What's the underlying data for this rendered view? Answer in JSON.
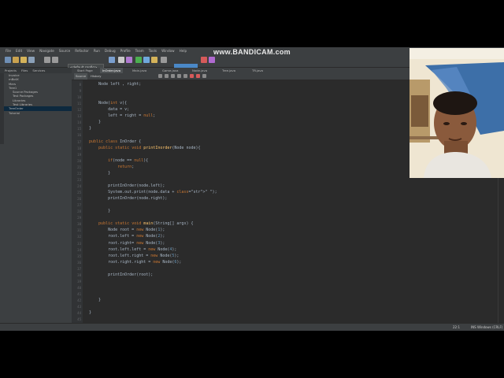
{
  "watermark": "www.BANDICAM.com",
  "menu": [
    "File",
    "Edit",
    "View",
    "Navigate",
    "Source",
    "Refactor",
    "Run",
    "Debug",
    "Profile",
    "Team",
    "Tools",
    "Window",
    "Help"
  ],
  "toolbar": {
    "config_value": "<default config>"
  },
  "left_panel": {
    "tabs": [
      "Projects",
      "Files",
      "Services"
    ],
    "tree": [
      {
        "label": "Invoice",
        "indent": 1,
        "selected": false
      },
      {
        "label": "mBotX",
        "indent": 1,
        "selected": false
      },
      {
        "label": "Mars",
        "indent": 1,
        "selected": false
      },
      {
        "label": "Tree1",
        "indent": 1,
        "selected": false
      },
      {
        "label": "Source Packages",
        "indent": 2,
        "selected": false
      },
      {
        "label": "Test Packages",
        "indent": 2,
        "selected": false
      },
      {
        "label": "Libraries",
        "indent": 2,
        "selected": false
      },
      {
        "label": "Test Libraries",
        "indent": 2,
        "selected": false
      },
      {
        "label": "TreeOrder",
        "indent": 1,
        "selected": true
      },
      {
        "label": "Tutorial",
        "indent": 1,
        "selected": false
      }
    ]
  },
  "editor_tabs": [
    "Start Page",
    "InOrder.java",
    "Main.java",
    "Game.java",
    "Node.java",
    "Tree.java",
    "TR.java"
  ],
  "editor_toolbar": {
    "source_label": "Source",
    "history_label": "History"
  },
  "code_lines": [
    {
      "n": "8",
      "html": "    Node left , right;"
    },
    {
      "n": "9",
      "html": ""
    },
    {
      "n": "10",
      "html": ""
    },
    {
      "n": "11",
      "html": "    Node(int v){"
    },
    {
      "n": "12",
      "html": "        data = v;"
    },
    {
      "n": "13",
      "html": "        left = right = null;"
    },
    {
      "n": "14",
      "html": "    }"
    },
    {
      "n": "15",
      "html": "}"
    },
    {
      "n": "16",
      "html": ""
    },
    {
      "n": "17",
      "html": "public class InOrder {"
    },
    {
      "n": "18",
      "html": "    public static void printInorder(Node node){"
    },
    {
      "n": "19",
      "html": ""
    },
    {
      "n": "20",
      "html": "        if(node == null){"
    },
    {
      "n": "21",
      "html": "            return;"
    },
    {
      "n": "22",
      "html": "        }"
    },
    {
      "n": "23",
      "html": ""
    },
    {
      "n": "24",
      "html": "        printInOrder(node.left);"
    },
    {
      "n": "25",
      "html": "        System.out.print(node.data + \" \");"
    },
    {
      "n": "26",
      "html": "        printInOrder(node.right);"
    },
    {
      "n": "27",
      "html": ""
    },
    {
      "n": "28",
      "html": "        }"
    },
    {
      "n": "29",
      "html": ""
    },
    {
      "n": "30",
      "html": "    public static void main(String[] args) {"
    },
    {
      "n": "31",
      "html": "        Node root = new Node(1);"
    },
    {
      "n": "32",
      "html": "        root.left = new Node(2);"
    },
    {
      "n": "33",
      "html": "        root.right= new Node(3);"
    },
    {
      "n": "34",
      "html": "        root.left.left = new Node(4);"
    },
    {
      "n": "35",
      "html": "        root.left.right = new Node(5);"
    },
    {
      "n": "36",
      "html": "        root.right.right = new Node(6);"
    },
    {
      "n": "37",
      "html": ""
    },
    {
      "n": "38",
      "html": "        printInOrder(root);"
    },
    {
      "n": "39",
      "html": ""
    },
    {
      "n": "40",
      "html": ""
    },
    {
      "n": "41",
      "html": ""
    },
    {
      "n": "42",
      "html": "    }"
    },
    {
      "n": "43",
      "html": ""
    },
    {
      "n": "44",
      "html": "}"
    },
    {
      "n": "45",
      "html": ""
    }
  ],
  "status": {
    "position": "22:1",
    "mode": "INS  Windows (CRLF)"
  },
  "colors": {
    "keyword": "#cc7832",
    "number": "#6897bb",
    "string": "#6a8759",
    "method": "#ffc66d",
    "background": "#2b2b2b",
    "accent": "#4a88c7"
  }
}
